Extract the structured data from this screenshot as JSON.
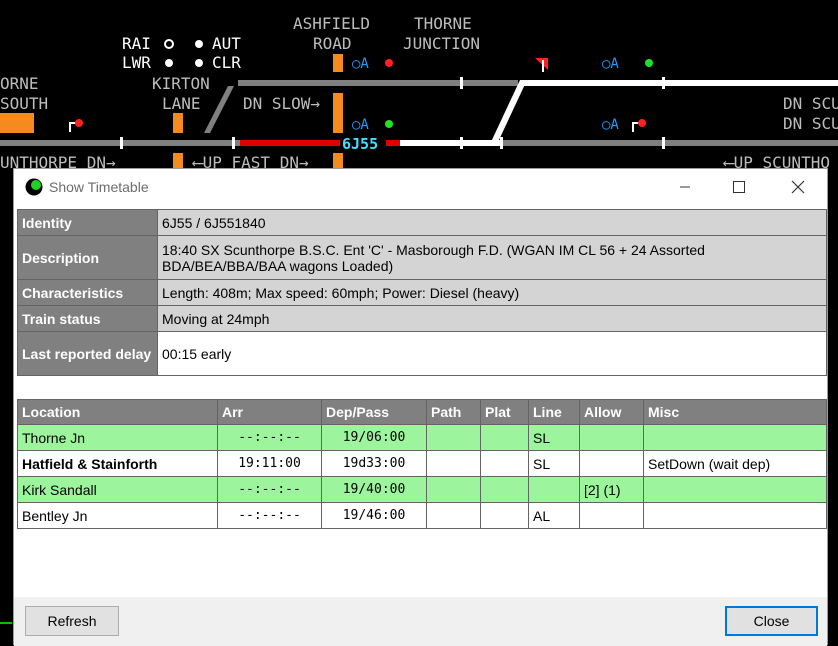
{
  "background": {
    "labels": {
      "rai": "RAI",
      "aut": "AUT",
      "lwr": "LWR",
      "clr": "CLR",
      "ashfield_1": "ASHFIELD",
      "ashfield_2": "ROAD",
      "thorne_1": "THORNE",
      "thorne_2": "JUNCTION",
      "thorne_south_1": "ORNE",
      "thorne_south_2": "SOUTH",
      "kirton_1": "KIRTON",
      "kirton_2": "LANE",
      "dn_slow": "DN SLOW→",
      "up_fast_dn": "⟵UP FAST DN→",
      "scunthorpe_dn": "UNTHORPE DN→",
      "up_scunthorpe": "⟵UP SCUNTHO",
      "dn_scu_1": "DN SCU",
      "dn_scu_2": "DN SCU",
      "train_id": "6J55",
      "signal_a1": "○A",
      "signal_a2": "○A",
      "signal_a3": "○A",
      "signal_a4": "○A"
    }
  },
  "dialog": {
    "title": "Show Timetable",
    "info_rows": [
      {
        "label": "Identity",
        "value": "6J55 / 6J551840"
      },
      {
        "label": "Description",
        "value": "18:40 SX Scunthorpe B.S.C. Ent 'C' - Masborough F.D. (WGAN IM CL 56 + 24 Assorted BDA/BEA/BBA/BAA wagons Loaded)"
      },
      {
        "label": "Characteristics",
        "value": "Length: 408m; Max speed: 60mph; Power: Diesel (heavy)"
      },
      {
        "label": "Train status",
        "value": "Moving at 24mph"
      },
      {
        "label": "Last reported delay",
        "value": "00:15 early"
      }
    ],
    "columns": [
      "Location",
      "Arr",
      "Dep/Pass",
      "Path",
      "Plat",
      "Line",
      "Allow",
      "Misc"
    ],
    "rows": [
      {
        "location": "Thorne Jn",
        "arr": "--:--:--",
        "dep": "19/06:00",
        "path": "",
        "plat": "",
        "line": "SL",
        "allow": "",
        "misc": ""
      },
      {
        "location": "Hatfield & Stainforth",
        "arr": "19:11:00",
        "dep": "19d33:00",
        "path": "",
        "plat": "",
        "line": "SL",
        "allow": "",
        "misc": "SetDown (wait dep)"
      },
      {
        "location": "Kirk Sandall",
        "arr": "--:--:--",
        "dep": "19/40:00",
        "path": "",
        "plat": "",
        "line": "",
        "allow": "[2] (1)",
        "misc": ""
      },
      {
        "location": "Bentley Jn",
        "arr": "--:--:--",
        "dep": "19/46:00",
        "path": "",
        "plat": "",
        "line": "AL",
        "allow": "",
        "misc": ""
      }
    ],
    "refresh_label": "Refresh",
    "close_label": "Close"
  }
}
